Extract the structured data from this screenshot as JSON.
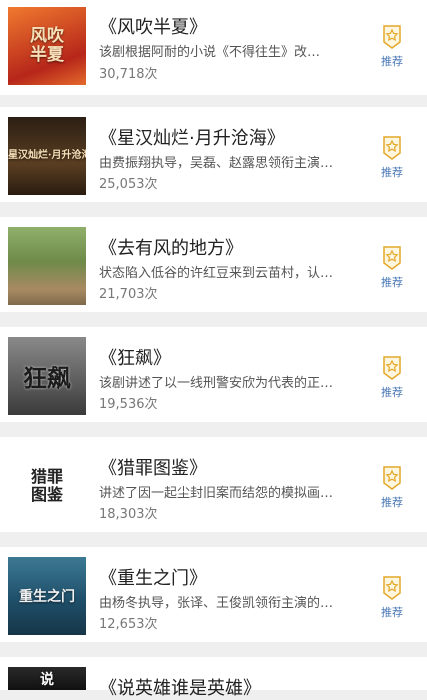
{
  "items": [
    {
      "title": "《风吹半夏》",
      "desc": "该剧根据阿耐的小说《不得往生》改…",
      "count": "30,718次",
      "thumb_text": "风吹半夏",
      "thumb_bg": "#d9552a",
      "recommend": "推荐"
    },
    {
      "title": "《星汉灿烂·月升沧海》",
      "desc": "由费振翔执导，吴磊、赵露思领衔主演…",
      "count": "25,053次",
      "thumb_text": "星汉灿烂·月升沧海",
      "thumb_bg": "#3a2a1c",
      "recommend": "推荐"
    },
    {
      "title": "《去有风的地方》",
      "desc": "状态陷入低谷的许红豆来到云苗村，认…",
      "count": "21,703次",
      "thumb_text": "",
      "thumb_bg": "#6f8a4a",
      "recommend": "推荐"
    },
    {
      "title": "《狂飙》",
      "desc": "该剧讲述了以一线刑警安欣为代表的正…",
      "count": "19,536次",
      "thumb_text": "狂飙",
      "thumb_bg": "#5b5b5b",
      "recommend": "推荐"
    },
    {
      "title": "《猎罪图鉴》",
      "desc": "讲述了因一起尘封旧案而结怨的模拟画…",
      "count": "18,303次",
      "thumb_text": "猎罪图鉴",
      "thumb_bg": "#ffffff",
      "recommend": "推荐"
    },
    {
      "title": "《重生之门》",
      "desc": "由杨冬执导，张译、王俊凯领衔主演的…",
      "count": "12,653次",
      "thumb_text": "重生之门",
      "thumb_bg": "#1f4f6a",
      "recommend": "推荐"
    },
    {
      "title": "《说英雄谁是英雄》",
      "desc": "",
      "count": "",
      "thumb_text": "说",
      "thumb_bg": "#1a1a1a",
      "recommend": ""
    }
  ],
  "colors": {
    "accent": "#e3a92b",
    "link": "#4a78b5"
  }
}
